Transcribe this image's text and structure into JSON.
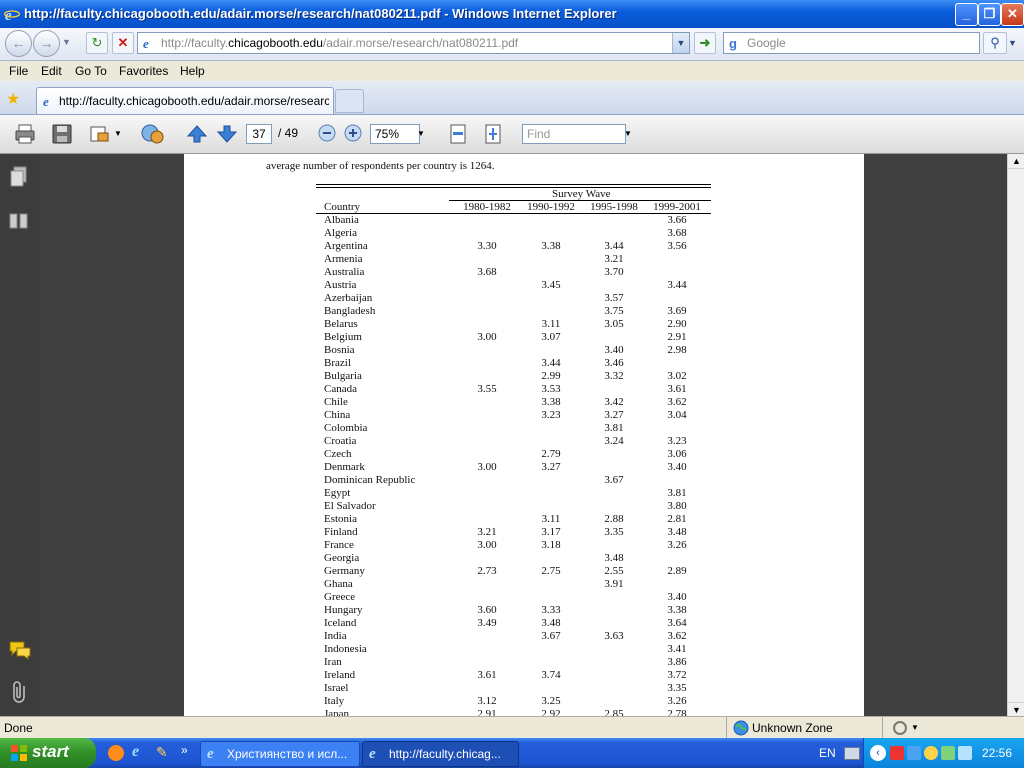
{
  "window": {
    "title": "http://faculty.chicagobooth.edu/adair.morse/research/nat080211.pdf - Windows Internet Explorer",
    "minimize": "_",
    "maximize": "❐",
    "close": "✕"
  },
  "address_bar": {
    "url_prefix": "http://faculty.",
    "url_domain": "chicagobooth.edu",
    "url_path": "/adair.morse/research/nat080211.pdf"
  },
  "search": {
    "placeholder": "Google"
  },
  "menu": [
    "File",
    "Edit",
    "Go To",
    "Favorites",
    "Help"
  ],
  "tab": {
    "label": "http://faculty.chicagobooth.edu/adair.morse/researc..."
  },
  "pdf_toolbar": {
    "page_current": "37",
    "page_total": "/ 49",
    "zoom": "75%",
    "find_placeholder": "Find"
  },
  "document": {
    "intro_text": "average number of respondents per country is 1264.",
    "table": {
      "group_header": "Survey Wave",
      "columns": [
        "Country",
        "1980-1982",
        "1990-1992",
        "1995-1998",
        "1999-2001"
      ],
      "rows": [
        [
          "Albania",
          "",
          "",
          "",
          "3.66"
        ],
        [
          "Algeria",
          "",
          "",
          "",
          "3.68"
        ],
        [
          "Argentina",
          "3.30",
          "3.38",
          "3.44",
          "3.56"
        ],
        [
          "Armenia",
          "",
          "",
          "3.21",
          ""
        ],
        [
          "Australia",
          "3.68",
          "",
          "3.70",
          ""
        ],
        [
          "Austria",
          "",
          "3.45",
          "",
          "3.44"
        ],
        [
          "Azerbaijan",
          "",
          "",
          "3.57",
          ""
        ],
        [
          "Bangladesh",
          "",
          "",
          "3.75",
          "3.69"
        ],
        [
          "Belarus",
          "",
          "3.11",
          "3.05",
          "2.90"
        ],
        [
          "Belgium",
          "3.00",
          "3.07",
          "",
          "2.91"
        ],
        [
          "Bosnia",
          "",
          "",
          "3.40",
          "2.98"
        ],
        [
          "Brazil",
          "",
          "3.44",
          "3.46",
          ""
        ],
        [
          "Bulgaria",
          "",
          "2.99",
          "3.32",
          "3.02"
        ],
        [
          "Canada",
          "3.55",
          "3.53",
          "",
          "3.61"
        ],
        [
          "Chile",
          "",
          "3.38",
          "3.42",
          "3.62"
        ],
        [
          "China",
          "",
          "3.23",
          "3.27",
          "3.04"
        ],
        [
          "Colombia",
          "",
          "",
          "3.81",
          ""
        ],
        [
          "Croatia",
          "",
          "",
          "3.24",
          "3.23"
        ],
        [
          "Czech",
          "",
          "2.79",
          "",
          "3.06"
        ],
        [
          "Denmark",
          "3.00",
          "3.27",
          "",
          "3.40"
        ],
        [
          "Dominican Republic",
          "",
          "",
          "3.67",
          ""
        ],
        [
          "Egypt",
          "",
          "",
          "",
          "3.81"
        ],
        [
          "El Salvador",
          "",
          "",
          "",
          "3.80"
        ],
        [
          "Estonia",
          "",
          "3.11",
          "2.88",
          "2.81"
        ],
        [
          "Finland",
          "3.21",
          "3.17",
          "3.35",
          "3.48"
        ],
        [
          "France",
          "3.00",
          "3.18",
          "",
          "3.26"
        ],
        [
          "Georgia",
          "",
          "",
          "3.48",
          ""
        ],
        [
          "Germany",
          "2.73",
          "2.75",
          "2.55",
          "2.89"
        ],
        [
          "Ghana",
          "",
          "",
          "3.91",
          ""
        ],
        [
          "Greece",
          "",
          "",
          "",
          "3.40"
        ],
        [
          "Hungary",
          "3.60",
          "3.33",
          "",
          "3.38"
        ],
        [
          "Iceland",
          "3.49",
          "3.48",
          "",
          "3.64"
        ],
        [
          "India",
          "",
          "3.67",
          "3.63",
          "3.62"
        ],
        [
          "Indonesia",
          "",
          "",
          "",
          "3.41"
        ],
        [
          "Iran",
          "",
          "",
          "",
          "3.86"
        ],
        [
          "Ireland",
          "3.61",
          "3.74",
          "",
          "3.72"
        ],
        [
          "Israel",
          "",
          "",
          "",
          "3.35"
        ],
        [
          "Italy",
          "3.12",
          "3.25",
          "",
          "3.26"
        ],
        [
          "Japan",
          "2.91",
          "2.92",
          "2.85",
          "2.78"
        ]
      ]
    }
  },
  "status_bar": {
    "left": "Done",
    "zone": "Unknown Zone"
  },
  "taskbar": {
    "start": "start",
    "tasks": [
      "Християнство и исл...",
      "http://faculty.chicag..."
    ],
    "lang": "EN",
    "clock": "22:56"
  }
}
